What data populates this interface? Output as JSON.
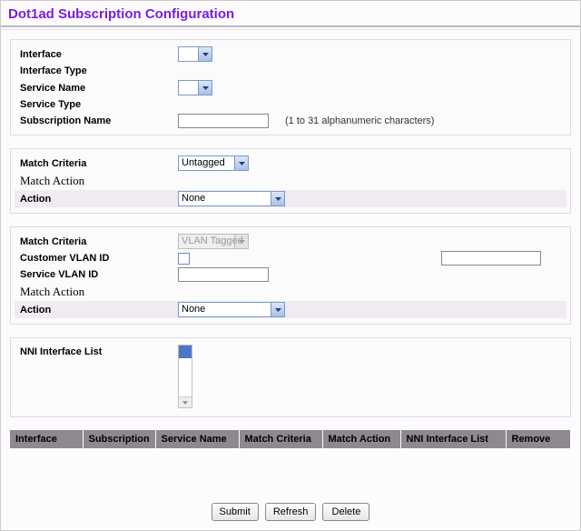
{
  "title": "Dot1ad Subscription Configuration",
  "panel1": {
    "interface_label": "Interface",
    "interface_type_label": "Interface Type",
    "service_name_label": "Service Name",
    "service_type_label": "Service Type",
    "subscription_name_label": "Subscription Name",
    "subscription_hint": "(1 to 31 alphanumeric characters)"
  },
  "panel2": {
    "match_criteria_label": "Match Criteria",
    "match_criteria_value": "Untagged",
    "match_action_heading": "Match Action",
    "action_label": "Action",
    "action_value": "None"
  },
  "panel3": {
    "match_criteria_label": "Match Criteria",
    "match_criteria_value": "VLAN Tagged",
    "customer_vlan_label": "Customer VLAN ID",
    "service_vlan_label": "Service VLAN ID",
    "match_action_heading": "Match Action",
    "action_label": "Action",
    "action_value": "None"
  },
  "panel4": {
    "nni_label": "NNI Interface List"
  },
  "table": {
    "cols": {
      "interface": "Interface",
      "subscription": "Subscription",
      "service_name": "Service Name",
      "match_criteria": "Match Criteria",
      "match_action": "Match Action",
      "nni_list": "NNI Interface List",
      "remove": "Remove"
    }
  },
  "buttons": {
    "submit": "Submit",
    "refresh": "Refresh",
    "delete": "Delete"
  }
}
